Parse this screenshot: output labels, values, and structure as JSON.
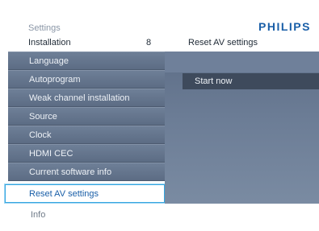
{
  "header": {
    "section_title": "Settings",
    "brand": "PHILIPS"
  },
  "breadcrumb": {
    "current": "Installation",
    "count": "8",
    "selected_item": "Reset AV settings"
  },
  "menu": {
    "items": [
      {
        "label": "Language",
        "selected": false
      },
      {
        "label": "Autoprogram",
        "selected": false
      },
      {
        "label": "Weak channel installation",
        "selected": false
      },
      {
        "label": "Source",
        "selected": false
      },
      {
        "label": "Clock",
        "selected": false
      },
      {
        "label": "HDMI CEC",
        "selected": false
      },
      {
        "label": "Current software info",
        "selected": false
      },
      {
        "label": "Reset AV settings",
        "selected": true
      }
    ]
  },
  "panel": {
    "option": "Start now"
  },
  "footer": {
    "info": "Info"
  },
  "colors": {
    "brand": "#1a5fa8",
    "menu_bg": "#6a7b93",
    "highlight_border": "#35a6e0"
  }
}
